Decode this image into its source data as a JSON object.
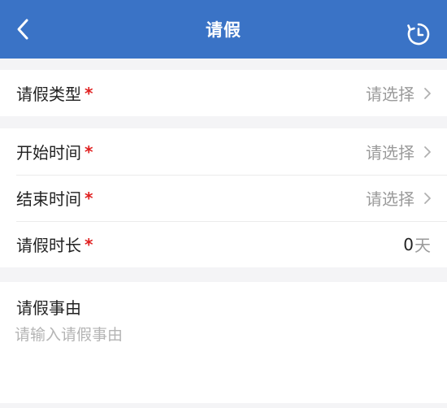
{
  "header": {
    "title": "请假",
    "bg_color": "#3a73c6"
  },
  "leave_type": {
    "label": "请假类型",
    "required_mark": "*",
    "value": "请选择"
  },
  "start_time": {
    "label": "开始时间",
    "required_mark": "*",
    "value": "请选择"
  },
  "end_time": {
    "label": "结束时间",
    "required_mark": "*",
    "value": "请选择"
  },
  "duration": {
    "label": "请假时长",
    "required_mark": "*",
    "value": "0",
    "unit": "天"
  },
  "reason": {
    "label": "请假事由",
    "placeholder": "请输入请假事由",
    "value": ""
  },
  "icons": {
    "back": "back-arrow-icon",
    "history": "history-clock-icon",
    "chevron": "chevron-right-icon"
  },
  "colors": {
    "required": "#e02020",
    "placeholder": "#9a9a9a"
  }
}
